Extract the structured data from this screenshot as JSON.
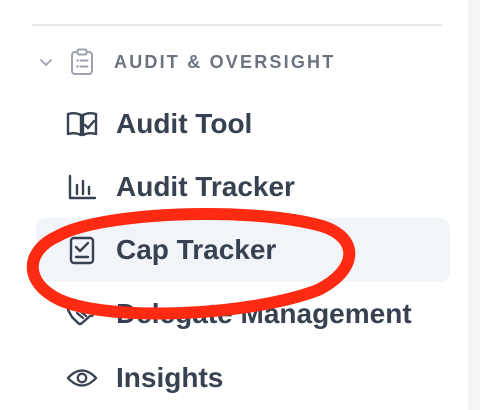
{
  "section": {
    "label": "AUDIT & OVERSIGHT",
    "icon": "clipboard-list-icon",
    "expanded": true
  },
  "items": [
    {
      "label": "Audit Tool",
      "icon": "book-check-icon",
      "active": false
    },
    {
      "label": "Audit Tracker",
      "icon": "bar-chart-icon",
      "active": false
    },
    {
      "label": "Cap Tracker",
      "icon": "clipboard-check-icon",
      "active": true
    },
    {
      "label": "Delegate Management",
      "icon": "handshake-icon",
      "active": false
    },
    {
      "label": "Insights",
      "icon": "eye-icon",
      "active": false
    }
  ],
  "colors": {
    "text": "#374151",
    "muted": "#6b7280",
    "active_bg": "#f1f4f9",
    "annotation": "#ff2a12"
  }
}
